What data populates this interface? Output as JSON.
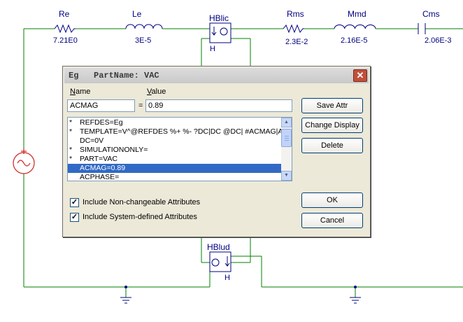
{
  "schematic": {
    "components": [
      {
        "label": "Re",
        "value": "7.21E0"
      },
      {
        "label": "Le",
        "value": "3E-5"
      },
      {
        "label": "HBlic",
        "pin": "H"
      },
      {
        "label": "Rms",
        "value": "2.3E-2"
      },
      {
        "label": "Mmd",
        "value": "2.16E-5"
      },
      {
        "label": "Cms",
        "value": "2.06E-3"
      },
      {
        "label": "HBlud",
        "pin": "H"
      }
    ],
    "wire_color": "#008000",
    "component_color": "#000080",
    "source_color": "#d02020"
  },
  "dialog": {
    "title": "Eg   PartName: VAC",
    "close_glyph": "✕",
    "name_label_prefix": "N",
    "name_label_rest": "ame",
    "value_label_prefix": "V",
    "value_label_rest": "alue",
    "name_value": "ACMAG",
    "equals": "=",
    "value_value": "0.89",
    "attributes": [
      {
        "mark": "*",
        "text": "REFDES=Eg",
        "selected": false
      },
      {
        "mark": "*",
        "text": "TEMPLATE=V^@REFDES %+ %- ?DC|DC @DC| #ACMAG|A",
        "selected": false
      },
      {
        "mark": "",
        "text": "DC=0V",
        "selected": false
      },
      {
        "mark": "*",
        "text": "SIMULATIONONLY=",
        "selected": false
      },
      {
        "mark": "*",
        "text": "PART=VAC",
        "selected": false
      },
      {
        "mark": "",
        "text": "ACMAG=0.89",
        "selected": true
      },
      {
        "mark": "",
        "text": "ACPHASE=",
        "selected": false
      }
    ],
    "buttons": {
      "save_attr": "Save Attr",
      "change_display": "Change Display",
      "delete": "Delete",
      "ok": "OK",
      "cancel": "Cancel"
    },
    "checkboxes": [
      {
        "label": "Include Non-changeable Attributes",
        "checked": true
      },
      {
        "label": "Include System-defined Attributes",
        "checked": true
      }
    ],
    "check_glyph": "✓"
  }
}
